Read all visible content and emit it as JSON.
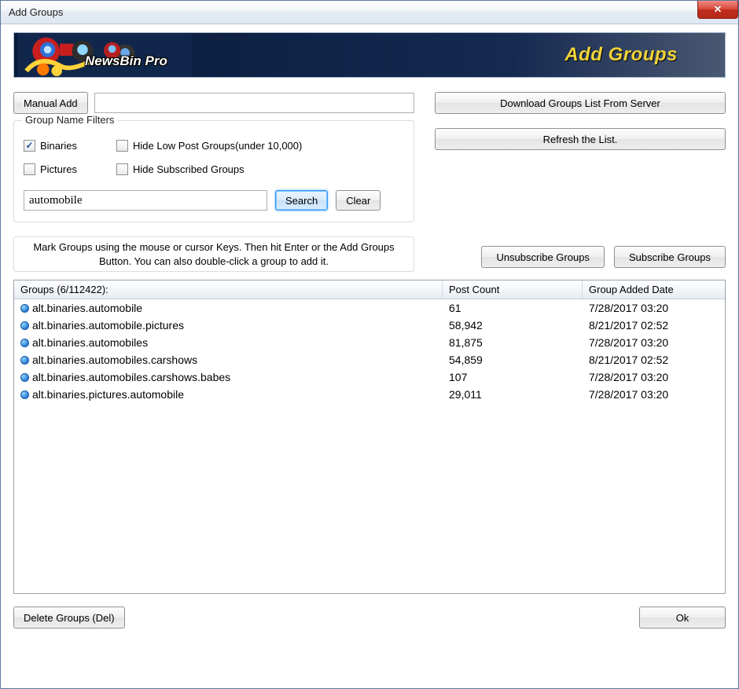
{
  "window": {
    "title": "Add Groups"
  },
  "banner": {
    "logo_text": "NewsBin Pro",
    "title": "Add Groups"
  },
  "toolbar": {
    "manual_add_label": "Manual Add",
    "manual_add_value": "",
    "download_list_label": "Download Groups List From Server",
    "refresh_label": "Refresh the List."
  },
  "filters": {
    "groupbox_title": "Group Name Filters",
    "binaries_label": "Binaries",
    "binaries_checked": true,
    "pictures_label": "Pictures",
    "pictures_checked": false,
    "hide_low_label": "Hide Low Post Groups(under 10,000)",
    "hide_low_checked": false,
    "hide_sub_label": "Hide Subscribed Groups",
    "hide_sub_checked": false,
    "search_value": "automobile",
    "search_label": "Search",
    "clear_label": "Clear"
  },
  "hint": {
    "text": "Mark Groups using the mouse or cursor Keys. Then hit Enter or the Add Groups Button. You can also double-click a group to add it."
  },
  "actions": {
    "unsubscribe_label": "Unsubscribe Groups",
    "subscribe_label": "Subscribe Groups",
    "delete_label": "Delete Groups (Del)",
    "ok_label": "Ok"
  },
  "list": {
    "header_groups": "Groups (6/112422):",
    "header_post_count": "Post Count",
    "header_date": "Group Added Date",
    "rows": [
      {
        "name": "alt.binaries.automobile",
        "post_count": "61",
        "date": "7/28/2017 03:20"
      },
      {
        "name": "alt.binaries.automobile.pictures",
        "post_count": "58,942",
        "date": "8/21/2017 02:52"
      },
      {
        "name": "alt.binaries.automobiles",
        "post_count": "81,875",
        "date": "7/28/2017 03:20"
      },
      {
        "name": "alt.binaries.automobiles.carshows",
        "post_count": "54,859",
        "date": "8/21/2017 02:52"
      },
      {
        "name": "alt.binaries.automobiles.carshows.babes",
        "post_count": "107",
        "date": "7/28/2017 03:20"
      },
      {
        "name": "alt.binaries.pictures.automobile",
        "post_count": "29,011",
        "date": "7/28/2017 03:20"
      }
    ]
  }
}
